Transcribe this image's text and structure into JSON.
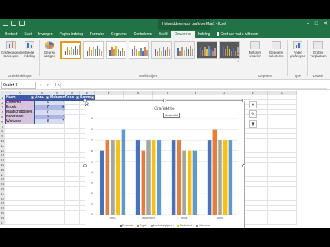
{
  "window": {
    "context_tools": "Hulpmiddelen voor grafieken",
    "doc_title": "Map1 - Excel",
    "win_buttons": [
      "–",
      "□",
      "✕"
    ]
  },
  "tabs": [
    "Bestand",
    "Start",
    "Invoegen",
    "Pagina-indeling",
    "Formules",
    "Gegevens",
    "Controleren",
    "Beeld",
    "Ontwerpen",
    "Indeling"
  ],
  "active_tab": "Ontwerpen",
  "tell_me": "Geef aan wat u wilt doen",
  "ribbon": {
    "add_element": "Grafiekonderdeel toevoegen",
    "quick_layout": "Snelle indeling",
    "change_colors": "Kleuren wijzigen",
    "group_layouts": "Grafiekindelingen",
    "group_styles": "Grafiekstijlen",
    "switch_row_col": "Rij/kolom wisselen",
    "select_data": "Gegevens selecteren",
    "group_data": "Gegevens",
    "change_type": "Ander grafiektype",
    "group_type": "Type",
    "move_chart": "Grafiek verplaatsen",
    "group_location": "Locatie",
    "scroll": [
      "▲",
      "▼",
      "≡"
    ]
  },
  "formula_bar": {
    "name_box": "Grafiek 3",
    "fx_symbols": "× ✓ fx"
  },
  "columns": [
    "A",
    "B",
    "C",
    "D",
    "E",
    "F",
    "G",
    "H",
    "I",
    "J",
    "K",
    "L"
  ],
  "rows": [
    "1",
    "2",
    "3",
    "4",
    "5",
    "6",
    "7",
    "8",
    "9",
    "10",
    "11",
    "12",
    "13",
    "14",
    "15",
    "16",
    "17",
    "18",
    "19",
    "20",
    "21",
    "22",
    "23",
    "24",
    "25",
    "26",
    "27"
  ],
  "table": {
    "headers": [
      "Naam",
      "Anna",
      "Mohamme",
      "Roos",
      "Sanne"
    ],
    "rows": [
      {
        "name": "Economie",
        "b": "6",
        "c": "7"
      },
      {
        "name": "Engels",
        "b": "7",
        "c": "6"
      },
      {
        "name": "Maatschappijleer 1",
        "b": "7",
        "c": "7"
      },
      {
        "name": "Nederlands",
        "b": "6",
        "c": "7"
      },
      {
        "name": "Wiskunde",
        "b": "8",
        "c": "7"
      }
    ]
  },
  "chart_data": {
    "type": "bar",
    "title": "Grafiektitel",
    "categories": [
      "Anna",
      "Mohammed",
      "Roos",
      "Sanne"
    ],
    "ylim": [
      0,
      9
    ],
    "yticks": [
      0,
      1,
      2,
      3,
      4,
      5,
      6,
      7,
      8,
      9
    ],
    "grid": true,
    "legend_position": "bottom",
    "series": [
      {
        "name": "Economie",
        "values": [
          6,
          7,
          7,
          7
        ],
        "color": "#4472c4"
      },
      {
        "name": "Engels",
        "values": [
          7,
          6,
          7,
          8
        ],
        "color": "#ed7d31"
      },
      {
        "name": "Maatschappijleer 1",
        "values": [
          7,
          7,
          6,
          7
        ],
        "color": "#a5a5a5"
      },
      {
        "name": "Nederlands",
        "values": [
          7,
          7,
          6,
          7
        ],
        "color": "#ffc000"
      },
      {
        "name": "Wiskunde",
        "values": [
          8,
          7,
          6,
          7
        ],
        "color": "#5b9bd5"
      }
    ]
  },
  "tooltip": "Grafiektitel",
  "side_tools": [
    "+",
    "✎",
    "▼"
  ]
}
